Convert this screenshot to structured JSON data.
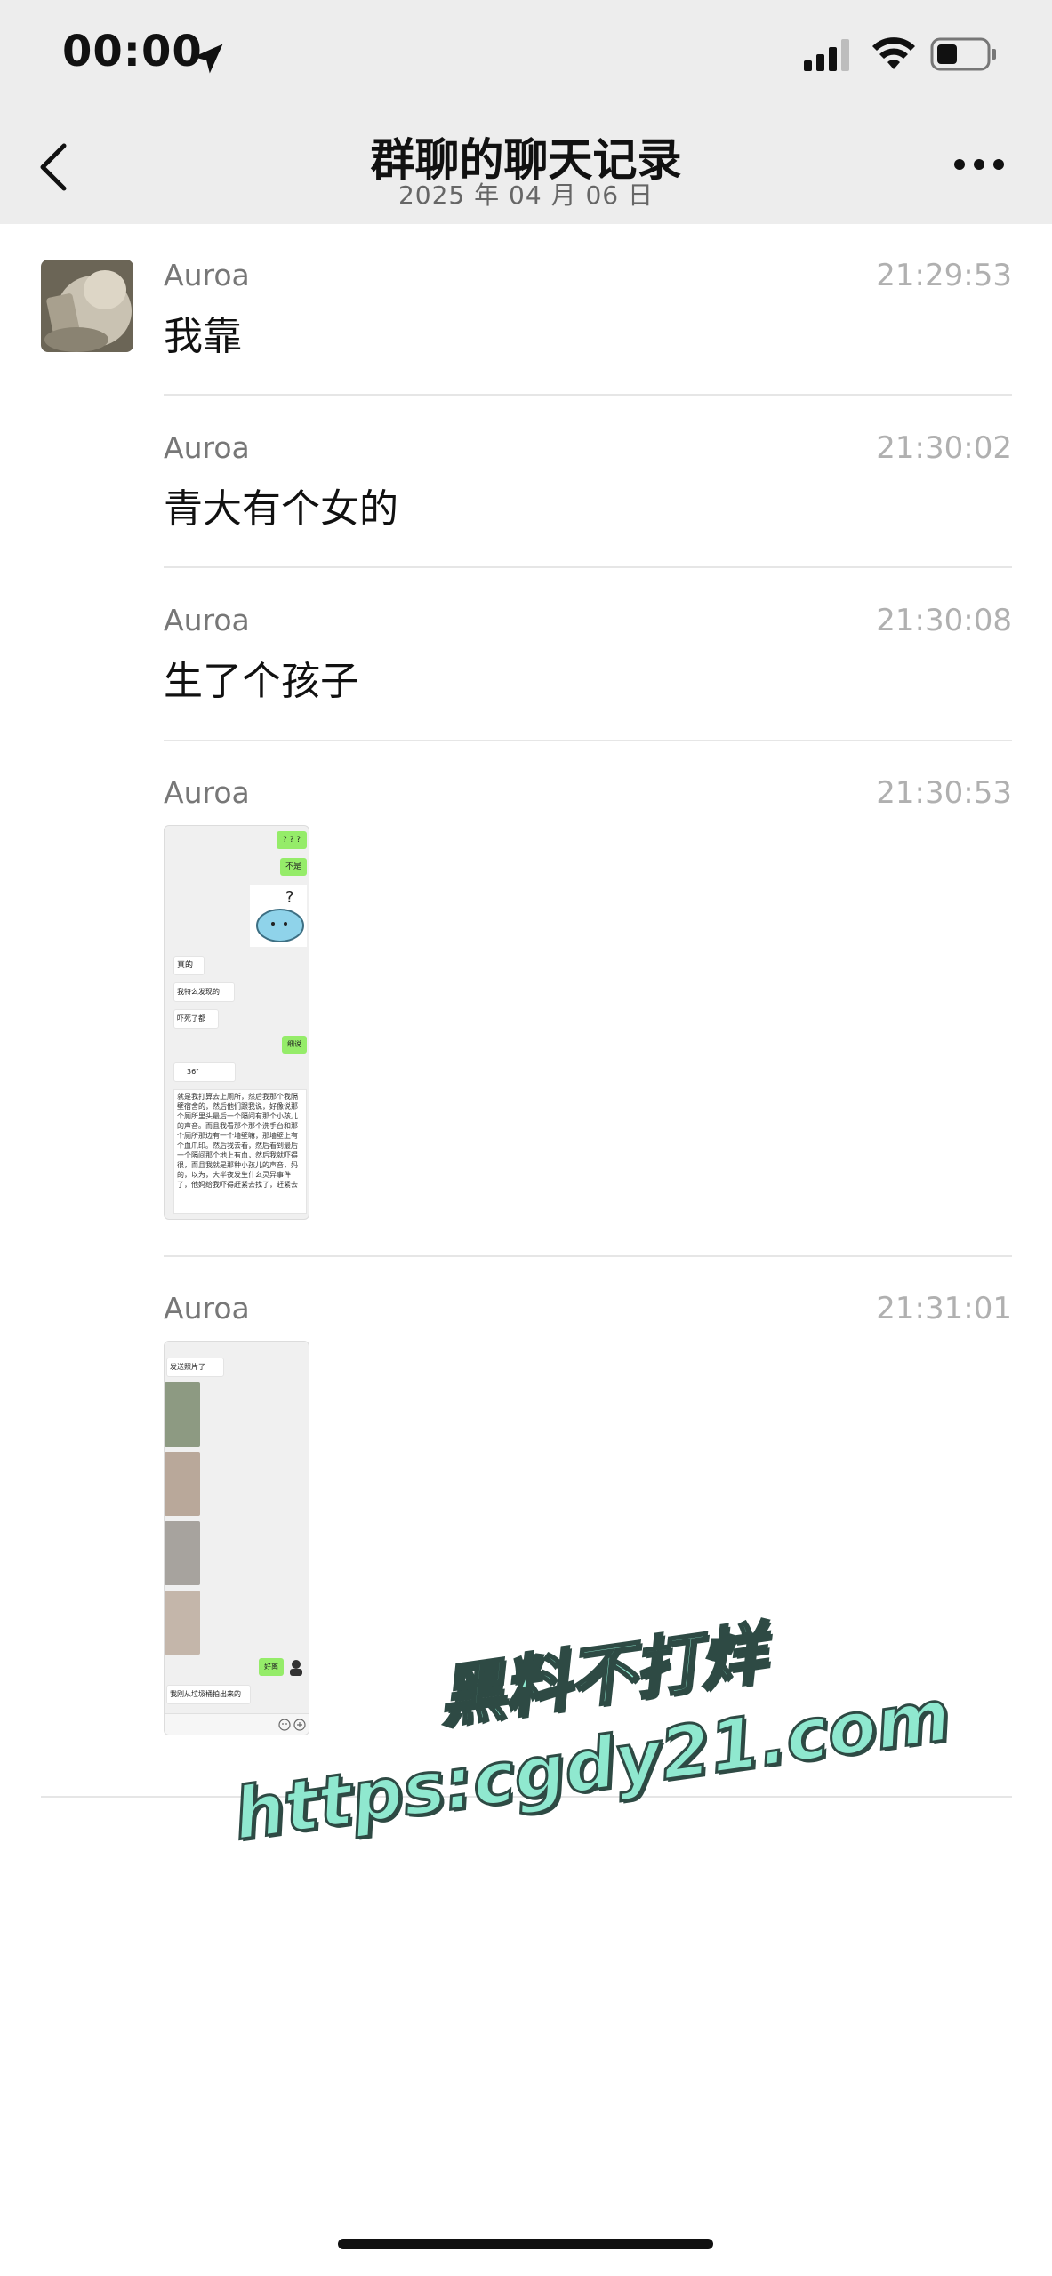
{
  "status_bar": {
    "time": "00:00",
    "icons": [
      "location-arrow-icon",
      "cellular-signal-icon",
      "wifi-icon",
      "battery-icon"
    ]
  },
  "nav": {
    "title": "群聊的聊天记录",
    "subtitle": "2025 年 04 月 06 日",
    "back_icon": "chevron-left-icon",
    "more_icon": "more-dots-icon"
  },
  "messages": [
    {
      "sender": "Auroa",
      "time": "21:29:53",
      "type": "text",
      "text": "我靠"
    },
    {
      "sender": "Auroa",
      "time": "21:30:02",
      "type": "text",
      "text": "青大有个女的"
    },
    {
      "sender": "Auroa",
      "time": "21:30:08",
      "type": "text",
      "text": "生了个孩子"
    },
    {
      "sender": "Auroa",
      "time": "21:30:53",
      "type": "image",
      "image_text": {
        "b1": "? ? ?",
        "b2": "不是",
        "b3": "真的",
        "b4": "我特么发现的",
        "b5": "吓死了都",
        "b6": "细说",
        "voice": "36\"",
        "long_text": "就是我打算去上厕所，然后我那个我隔壁宿舍的，然后他们跟我说，好像说那个厕所里头最后一个隔间有那个小孩儿的声音。而且我看那个那个洗手台和那个厕所那边有一个墙壁嘛，那墙壁上有个血爪印。然后我去看，然后看到最后一个隔间那个地上有血，然后我就吓得很，而且我就是那种小孩儿的声音，妈的，以为，大半夜发生什么灵异事件了，他妈给我吓得赶紧去找了，赶紧去"
      }
    },
    {
      "sender": "Auroa",
      "time": "21:31:01",
      "type": "image",
      "image_text": {
        "top": "发送照片了",
        "reply": "好离",
        "bottom": "我刚从垃圾桶拍出来的"
      }
    }
  ],
  "watermark": {
    "line1": "黑料不打烊",
    "line2": "https:cgdy21.com"
  },
  "colors": {
    "header_bg": "#ededed",
    "bubble_green": "#95ec69",
    "watermark_fill": "#8fe8cf"
  }
}
